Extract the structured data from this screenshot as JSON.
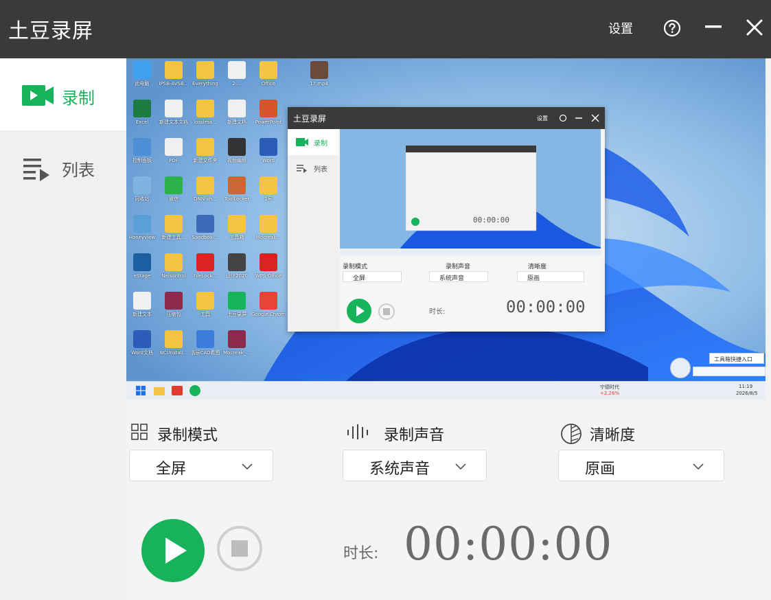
{
  "titlebar": {
    "title": "土豆录屏",
    "settings_label": "设置"
  },
  "sidebar": {
    "items": [
      {
        "label": "录制"
      },
      {
        "label": "列表"
      }
    ]
  },
  "preview": {
    "desktop_icons": [
      {
        "label": "此电脑"
      },
      {
        "label": "IPSB-AVSB..."
      },
      {
        "label": "Everything"
      },
      {
        "label": "2-..."
      },
      {
        "label": "Office"
      },
      {
        "label": "17.mp4"
      },
      {
        "label": "Excel"
      },
      {
        "label": "新建文本文档"
      },
      {
        "label": "lossless..."
      },
      {
        "label": "新建文档"
      },
      {
        "label": "PowerPoint"
      },
      {
        "label": "控制面板"
      },
      {
        "label": "PDF"
      },
      {
        "label": "新建文件夹"
      },
      {
        "label": "视频编辑"
      },
      {
        "label": "Word"
      },
      {
        "label": "回收站"
      },
      {
        "label": "微信"
      },
      {
        "label": "DNN-xh..."
      },
      {
        "label": "ToolLocker"
      },
      {
        "label": "1号"
      },
      {
        "label": "Honeyview"
      },
      {
        "label": "新建工具..."
      },
      {
        "label": "Sandboxi..."
      },
      {
        "label": "工具箱"
      },
      {
        "label": "Mocreak..."
      },
      {
        "label": "eStage"
      },
      {
        "label": "Nelsontrol"
      },
      {
        "label": "FileLock..."
      },
      {
        "label": "设计2020"
      },
      {
        "label": "WPS Office"
      },
      {
        "label": "新建文本"
      },
      {
        "label": "压缩包"
      },
      {
        "label": "工具"
      },
      {
        "label": "土豆录屏"
      },
      {
        "label": "Google Chrome"
      },
      {
        "label": "Word文档"
      },
      {
        "label": "BCUnstall..."
      },
      {
        "label": "浩辰CAD看图"
      },
      {
        "label": "Mocreak_..."
      }
    ],
    "taskbar": {
      "stock_name": "宁德时代",
      "stock_change": "+2.26%",
      "time": "11:19",
      "date": "2026/8/5"
    },
    "toolbox_tooltip": "工具箱快捷入口",
    "inner_window": {
      "title": "土豆录屏",
      "settings": "设置",
      "rec_label": "录制",
      "list_label": "列表",
      "mode_label": "录制模式",
      "mode_value": "全屏",
      "sound_label": "录制声音",
      "sound_value": "系统声音",
      "quality_label": "清晰度",
      "quality_value": "原画",
      "duration_label": "时长:",
      "duration_value": "00:00:00"
    }
  },
  "settings": {
    "mode": {
      "label": "录制模式",
      "value": "全屏"
    },
    "sound": {
      "label": "录制声音",
      "value": "系统声音"
    },
    "quality": {
      "label": "清晰度",
      "value": "原画"
    }
  },
  "control": {
    "duration_label": "时长:",
    "duration_value": "00:00:00"
  },
  "colors": {
    "accent": "#16b35a",
    "titlebar": "#3a3a3a"
  }
}
